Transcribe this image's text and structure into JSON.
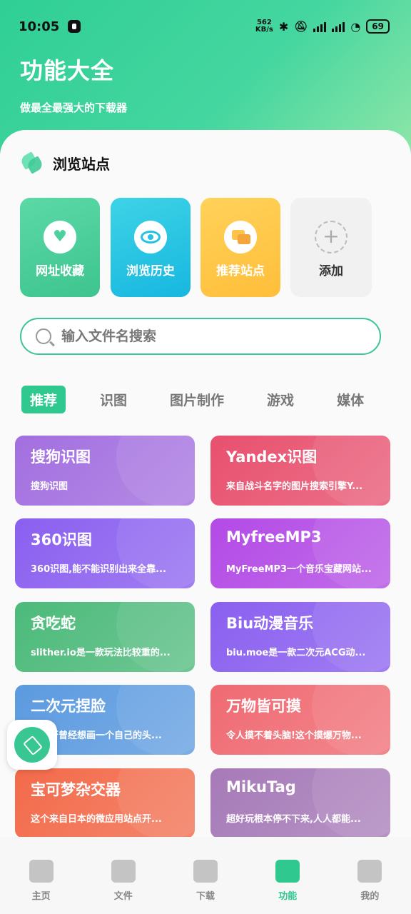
{
  "status_bar": {
    "time": "10:05",
    "speed_value": "562",
    "speed_unit": "KB/s",
    "battery": "69"
  },
  "header": {
    "title": "功能大全",
    "subtitle": "做最全最强大的下载器"
  },
  "section": {
    "title": "浏览站点"
  },
  "shortcuts": [
    {
      "label": "网址收藏",
      "icon": "heart-icon"
    },
    {
      "label": "浏览历史",
      "icon": "eye-icon"
    },
    {
      "label": "推荐站点",
      "icon": "chat-icon"
    },
    {
      "label": "添加",
      "icon": "plus-icon"
    }
  ],
  "search": {
    "placeholder": "输入文件名搜索"
  },
  "tabs": [
    "推荐",
    "识图",
    "图片制作",
    "游戏",
    "媒体"
  ],
  "cards": [
    {
      "title": "搜狗识图",
      "desc": "搜狗识图",
      "color": "#a36fe0"
    },
    {
      "title": "Yandex识图",
      "desc": "来自战斗名字的图片搜索引擎Y...",
      "color": "#e8506e"
    },
    {
      "title": "360识图",
      "desc": "360识图,能不能识别出来全靠...",
      "color": "#8a5ff0"
    },
    {
      "title": "MyfreeMP3",
      "desc": "MyFreeMP3一个音乐宝藏网站...",
      "color": "#b34ae6"
    },
    {
      "title": "贪吃蛇",
      "desc": "slither.io是一款玩法比较重的...",
      "color": "#4cba7a"
    },
    {
      "title": "Biu动漫音乐",
      "desc": "biu.moe是一款二次元ACG动...",
      "color": "#8a5ff0"
    },
    {
      "title": "二次元捏脸",
      "desc": "你是否曾经想画一个自己的头...",
      "color": "#5b9ae0"
    },
    {
      "title": "万物皆可摸",
      "desc": "令人摸不着头脑!这个摸爆万物...",
      "color": "#f06a72"
    },
    {
      "title": "宝可梦杂交器",
      "desc": "这个来自日本的微应用站点开...",
      "color": "#f36a4a"
    },
    {
      "title": "MikuTag",
      "desc": "超好玩根本停不下来,人人都能...",
      "color": "#a67ab8"
    }
  ],
  "nav": [
    {
      "label": "主页",
      "icon": "home-icon"
    },
    {
      "label": "文件",
      "icon": "book-icon"
    },
    {
      "label": "下载",
      "icon": "chart-icon"
    },
    {
      "label": "功能",
      "icon": "chat-icon"
    },
    {
      "label": "我的",
      "icon": "user-icon"
    }
  ],
  "active_nav": "功能"
}
